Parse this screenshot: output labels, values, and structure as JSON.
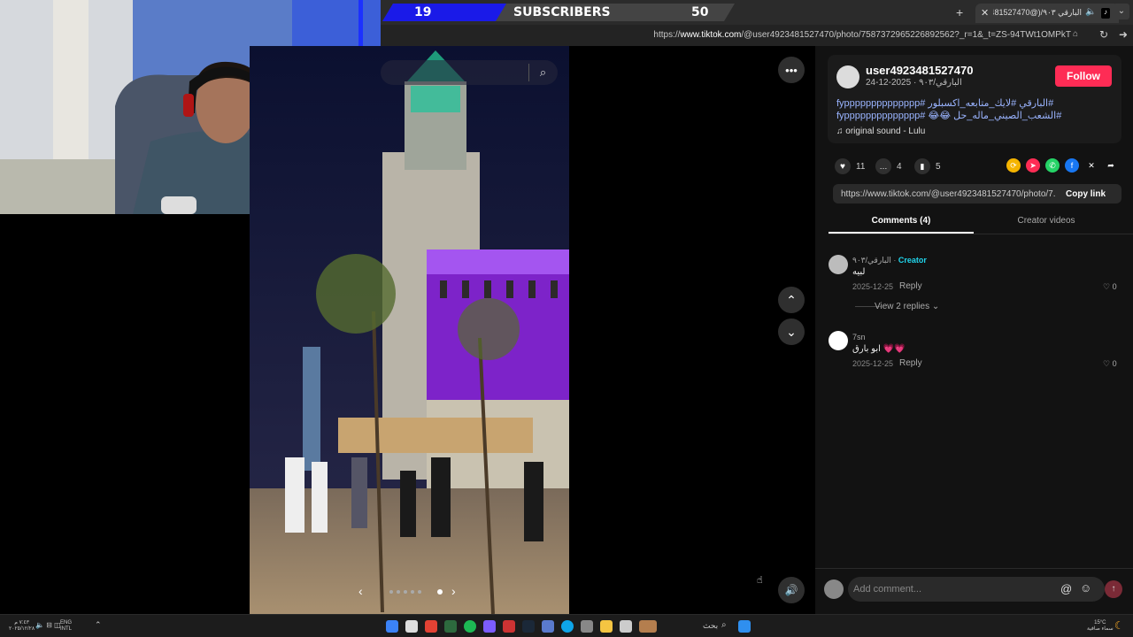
{
  "overlay": {
    "subs_current": "19",
    "subs_label": "SUBSCRIBERS",
    "subs_goal": "50"
  },
  "browser": {
    "tab_title": "البارقي ٩٠٣/(@user4923481527470",
    "url_prefix": "https://",
    "url_domain": "www.tiktok.com",
    "url_path": "/@user4923481527470/photo/7587372965226892562?_r=1&_t=ZS-94TWt1OMPkT"
  },
  "post": {
    "username": "user4923481527470",
    "subline": "البارقي/٩٠٣ · 2025-12-24",
    "follow_label": "Follow",
    "description_line1": "#البارقي #لايك_متابعه_اكسبلور #fypppppppppppppp",
    "description_line2": "#الشعب_الصيني_ماله_حل 😂😂 #fypppppppppppppp",
    "music": "original sound - Lulu",
    "likes": "11",
    "comments": "4",
    "saves": "5",
    "link": "https://www.tiktok.com/@user4923481527470/photo/7...",
    "copy_link_label": "Copy link",
    "tab_comments": "Comments (4)",
    "tab_creator": "Creator videos"
  },
  "comments": [
    {
      "name": "البارقي/٩٠٣",
      "creator_tag": "Creator",
      "text": "لبيه",
      "date": "2025-12-25",
      "reply_label": "Reply",
      "likes": "0",
      "view_replies": "View 2 replies"
    },
    {
      "name": "7sn",
      "text": "ابو بارق 💗💗",
      "date": "2025-12-25",
      "reply_label": "Reply",
      "likes": "0"
    }
  ],
  "composer": {
    "placeholder": "Add comment..."
  },
  "taskbar": {
    "lang_top": "ENG",
    "lang_bottom": "INTL",
    "search_label": "بحث",
    "weather_temp": "15°C",
    "weather_desc": "سماء صافية"
  },
  "colors": {
    "accent": "#fe2c55",
    "banner_blue": "#1a1ae8"
  }
}
